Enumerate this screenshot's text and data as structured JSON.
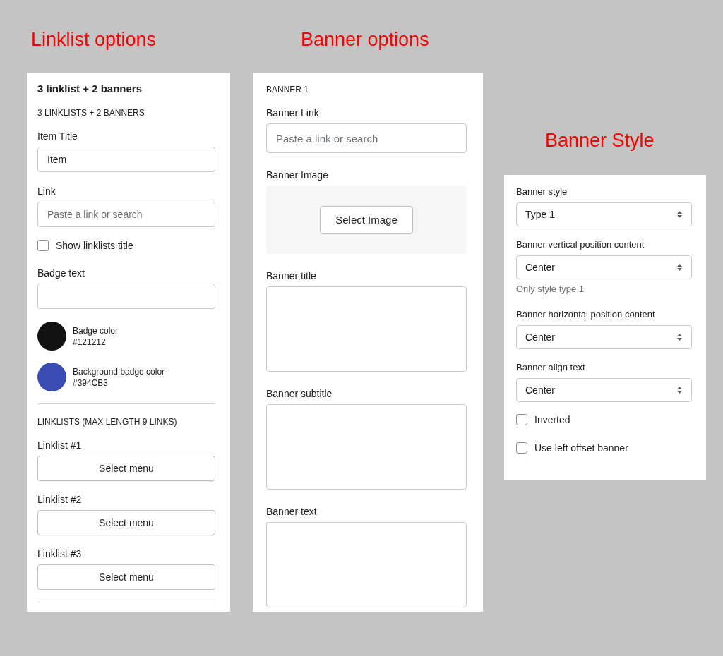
{
  "columns": [
    {
      "heading": "Linklist options",
      "items": [
        {
          "kind": "title",
          "text": "3 linklist + 2 banners"
        },
        {
          "kind": "caption",
          "text": "3 LINKLISTS + 2 BANNERS"
        },
        {
          "kind": "text",
          "label": "Item Title",
          "value": "Item"
        },
        {
          "kind": "text",
          "label": "Link",
          "placeholder": "Paste a link or search"
        },
        {
          "kind": "checkbox",
          "label": "Show linklists title",
          "checked": false
        },
        {
          "kind": "text",
          "label": "Badge text"
        },
        {
          "kind": "color",
          "label": "Badge color",
          "value": "#121212",
          "color": "#121212"
        },
        {
          "kind": "color",
          "label": "Background badge color",
          "value": "#394CB3",
          "color": "#394cb3"
        },
        {
          "kind": "divider"
        },
        {
          "kind": "caption",
          "text": "LINKLISTS (MAX LENGTH 9 LINKS)"
        },
        {
          "kind": "menu",
          "label": "Linklist #1",
          "button": "Select menu"
        },
        {
          "kind": "menu",
          "label": "Linklist #2",
          "button": "Select menu"
        },
        {
          "kind": "menu",
          "label": "Linklist #3",
          "button": "Select menu"
        },
        {
          "kind": "divider"
        }
      ]
    },
    {
      "heading": "Banner options",
      "items": [
        {
          "kind": "caption",
          "text": "BANNER 1"
        },
        {
          "kind": "text",
          "label": "Banner Link",
          "placeholder": "Paste a link or search"
        },
        {
          "kind": "image",
          "label": "Banner Image",
          "button": "Select Image"
        },
        {
          "kind": "textarea",
          "label": "Banner title"
        },
        {
          "kind": "textarea",
          "label": "Banner subtitle"
        },
        {
          "kind": "textarea",
          "label": "Banner text"
        }
      ]
    },
    {
      "heading": "Banner Style",
      "items": [
        {
          "kind": "select",
          "label": "Banner style",
          "value": "Type 1"
        },
        {
          "kind": "select",
          "label": "Banner vertical position content",
          "value": "Center",
          "note": "Only style type 1"
        },
        {
          "kind": "select",
          "label": "Banner horizontal position content",
          "value": "Center"
        },
        {
          "kind": "select",
          "label": "Banner align text",
          "value": "Center"
        },
        {
          "kind": "checkbox",
          "label": "Inverted",
          "checked": false
        },
        {
          "kind": "checkbox",
          "label": "Use left offset banner",
          "checked": false
        }
      ]
    }
  ]
}
